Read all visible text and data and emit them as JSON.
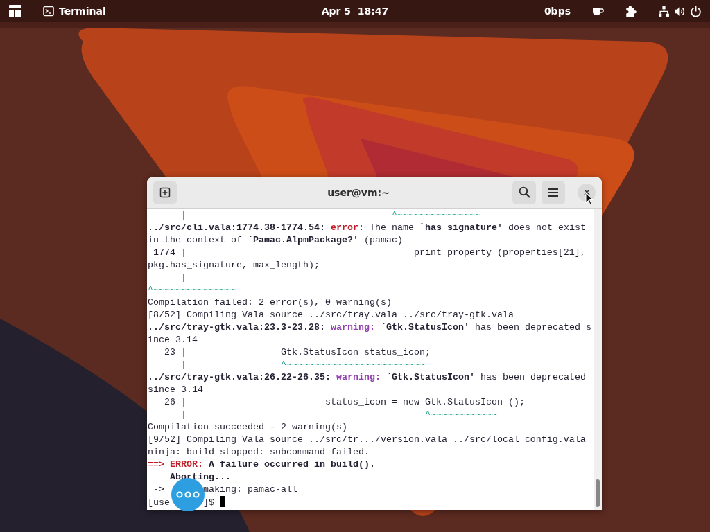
{
  "top_bar": {
    "app_name": "Terminal",
    "clock": "Apr 5  18:47",
    "network_speed": "0bps"
  },
  "window": {
    "title": "user@vm:~",
    "lines": [
      [
        {
          "kind": "plain",
          "text": "      |                                     "
        },
        {
          "kind": "caret",
          "text": "^~~~~~~~~~~~~~~~"
        }
      ],
      [
        {
          "kind": "bold",
          "text": "../src/cli.vala:1774.38-1774.54: "
        },
        {
          "kind": "error",
          "text": "error:"
        },
        {
          "kind": "plain",
          "text": " The name "
        },
        {
          "kind": "bold",
          "text": "`has_signature'"
        },
        {
          "kind": "plain",
          "text": " does not exist"
        }
      ],
      [
        {
          "kind": "plain",
          "text": "in the context of "
        },
        {
          "kind": "bold",
          "text": "`Pamac.AlpmPackage?'"
        },
        {
          "kind": "plain",
          "text": " (pamac)"
        }
      ],
      [
        {
          "kind": "plain",
          "text": " 1774 |                                         print_property (properties[21],"
        }
      ],
      [
        {
          "kind": "plain",
          "text": "pkg.has_signature, max_length);"
        }
      ],
      [
        {
          "kind": "plain",
          "text": "      |"
        }
      ],
      [
        {
          "kind": "caret",
          "text": "^~~~~~~~~~~~~~~~"
        }
      ],
      [
        {
          "kind": "plain",
          "text": "Compilation failed: 2 error(s), 0 warning(s)"
        }
      ],
      [
        {
          "kind": "plain",
          "text": "[8/52] Compiling Vala source ../src/tray.vala ../src/tray-gtk.vala"
        }
      ],
      [
        {
          "kind": "bold",
          "text": "../src/tray-gtk.vala:23.3-23.28: "
        },
        {
          "kind": "warning",
          "text": "warning:"
        },
        {
          "kind": "bold",
          "text": " `Gtk.StatusIcon'"
        },
        {
          "kind": "plain",
          "text": " has been deprecated s"
        }
      ],
      [
        {
          "kind": "plain",
          "text": "ince 3.14"
        }
      ],
      [
        {
          "kind": "plain",
          "text": "   23 |                 Gtk.StatusIcon status_icon;"
        }
      ],
      [
        {
          "kind": "plain",
          "text": "      |                 "
        },
        {
          "kind": "caret",
          "text": "^~~~~~~~~~~~~~~~~~~~~~~~~~"
        }
      ],
      [
        {
          "kind": "bold",
          "text": "../src/tray-gtk.vala:26.22-26.35: "
        },
        {
          "kind": "warning",
          "text": "warning:"
        },
        {
          "kind": "bold",
          "text": " `Gtk.StatusIcon'"
        },
        {
          "kind": "plain",
          "text": " has been deprecated"
        }
      ],
      [
        {
          "kind": "plain",
          "text": "since 3.14"
        }
      ],
      [
        {
          "kind": "plain",
          "text": "   26 |                         status_icon = new Gtk.StatusIcon ();"
        }
      ],
      [
        {
          "kind": "plain",
          "text": "      |                                           "
        },
        {
          "kind": "caret",
          "text": "^~~~~~~~~~~~~"
        }
      ],
      [
        {
          "kind": "plain",
          "text": "Compilation succeeded - 2 warning(s)"
        }
      ],
      [
        {
          "kind": "plain",
          "text": "[9/52] Compiling Vala source ../src/tr.../version.vala ../src/local_config.vala"
        }
      ],
      [
        {
          "kind": "plain",
          "text": "ninja: build stopped: subcommand failed."
        }
      ],
      [
        {
          "kind": "error",
          "text": "==> ERROR:"
        },
        {
          "kind": "bold",
          "text": " A failure occurred in build()."
        }
      ],
      [
        {
          "kind": "bold",
          "text": "    Aborting..."
        }
      ],
      [
        {
          "kind": "plain",
          "text": " ->       making: pamac-all"
        }
      ],
      [
        {
          "kind": "plain",
          "text": "[use      ]$ "
        },
        {
          "kind": "cursor"
        }
      ]
    ]
  }
}
